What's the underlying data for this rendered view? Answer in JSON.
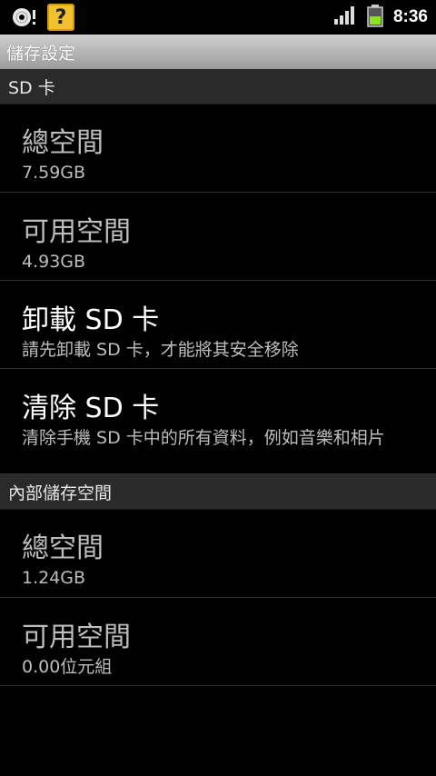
{
  "status_bar": {
    "time": "8:36",
    "icons": {
      "disc": "disc-icon",
      "help": "help-icon",
      "signal": "signal-icon",
      "battery": "battery-icon"
    },
    "help_glyph": "?"
  },
  "title_bar": {
    "title": "儲存設定"
  },
  "sections": [
    {
      "header": "SD 卡",
      "items": [
        {
          "title": "總空間",
          "summary": "7.59GB",
          "enabled": false
        },
        {
          "title": "可用空間",
          "summary": "4.93GB",
          "enabled": false
        },
        {
          "title": "卸載 SD 卡",
          "summary": "請先卸載 SD 卡，才能將其安全移除",
          "enabled": true
        },
        {
          "title": "清除 SD 卡",
          "summary": "清除手機 SD 卡中的所有資料，例如音樂和相片",
          "enabled": true
        }
      ]
    },
    {
      "header": "內部儲存空間",
      "items": [
        {
          "title": "總空間",
          "summary": "1.24GB",
          "enabled": false
        },
        {
          "title": "可用空間",
          "summary": "0.00位元組",
          "enabled": false
        }
      ]
    }
  ],
  "colors": {
    "background": "#000000",
    "title_bar": "#b4b4b4",
    "section_header": "#2a2a2a",
    "battery": "#7ed321"
  }
}
